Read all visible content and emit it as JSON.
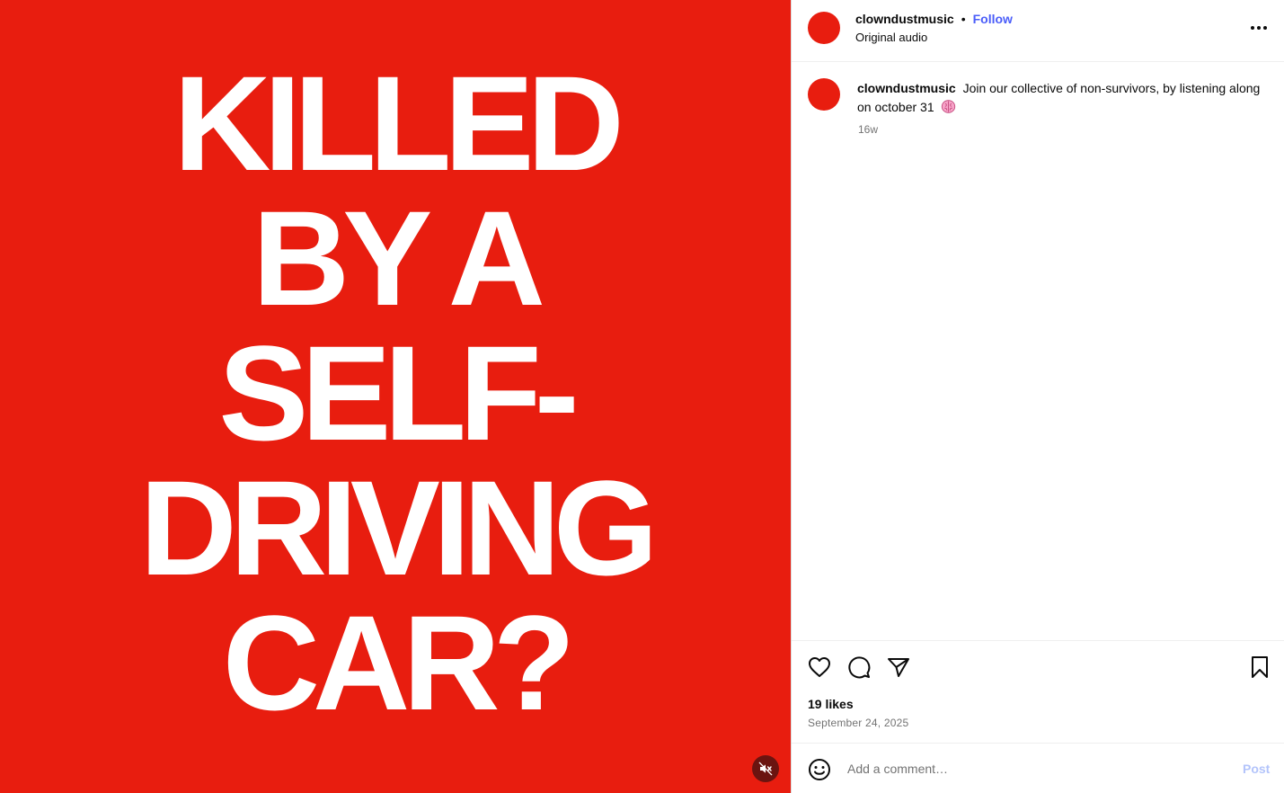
{
  "media": {
    "background_color": "#e81d0f",
    "text_lines": [
      "KILLED",
      "BY A",
      "SELF-",
      "DRIVING",
      "CAR?"
    ],
    "mute_icon": "speaker-muted-icon"
  },
  "post_header": {
    "username": "clowndustmusic",
    "separator": "•",
    "follow_label": "Follow",
    "audio_label": "Original audio",
    "more_icon": "more-horizontal-icon"
  },
  "caption": {
    "username": "clowndustmusic",
    "text": "Join our collective of non-survivors, by listening along on october 31",
    "emoji": "brain-emoji",
    "time_ago": "16w"
  },
  "actions": {
    "like_icon": "heart-icon",
    "comment_icon": "comment-bubble-icon",
    "share_icon": "paper-plane-icon",
    "save_icon": "bookmark-icon",
    "likes_text": "19 likes",
    "date_text": "September 24, 2025"
  },
  "comment_box": {
    "emoji_icon": "smiley-icon",
    "placeholder": "Add a comment…",
    "post_label": "Post"
  },
  "colors": {
    "accent": "#4a5df9",
    "post_disabled": "#b3c4fb",
    "avatar": "#e81d0f"
  }
}
